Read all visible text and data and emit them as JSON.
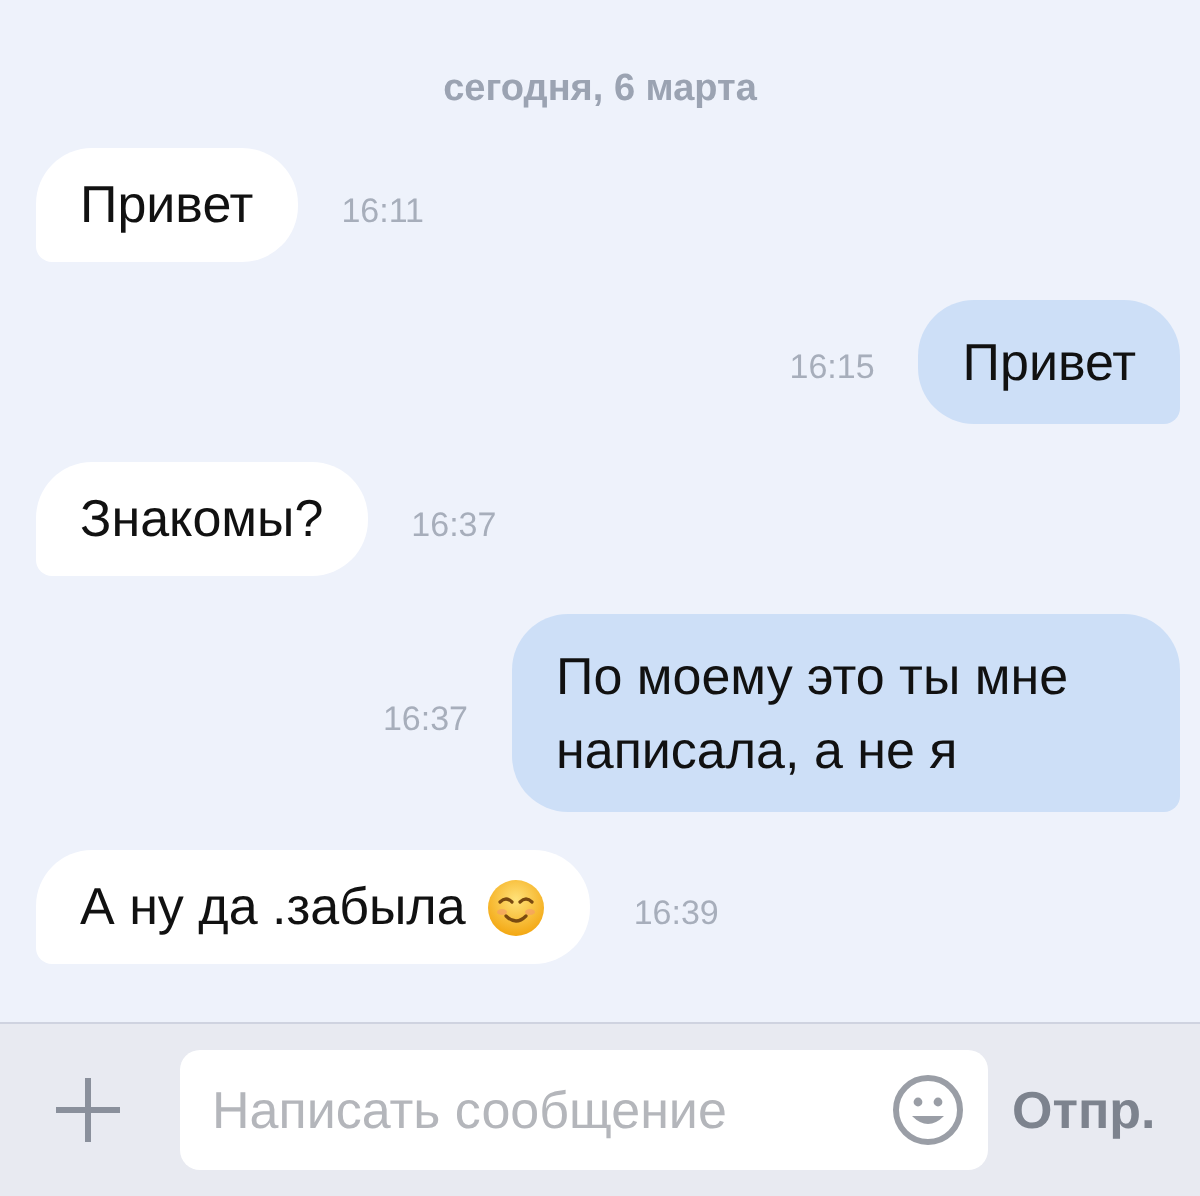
{
  "date_divider": "сегодня, 6 марта",
  "messages": [
    {
      "kind": "in",
      "text": "Привет",
      "time": "16:11",
      "emoji": false
    },
    {
      "kind": "out",
      "text": "Привет",
      "time": "16:15",
      "emoji": false
    },
    {
      "kind": "in",
      "text": "Знакомы?",
      "time": "16:37",
      "emoji": false
    },
    {
      "kind": "out",
      "text": "По моему это ты мне написала, а не я",
      "time": "16:37",
      "emoji": false
    },
    {
      "kind": "in",
      "text": "А ну да .забыла",
      "time": "16:39",
      "emoji": true
    }
  ],
  "composer": {
    "placeholder": "Написать сообщение",
    "send": "Отпр."
  }
}
